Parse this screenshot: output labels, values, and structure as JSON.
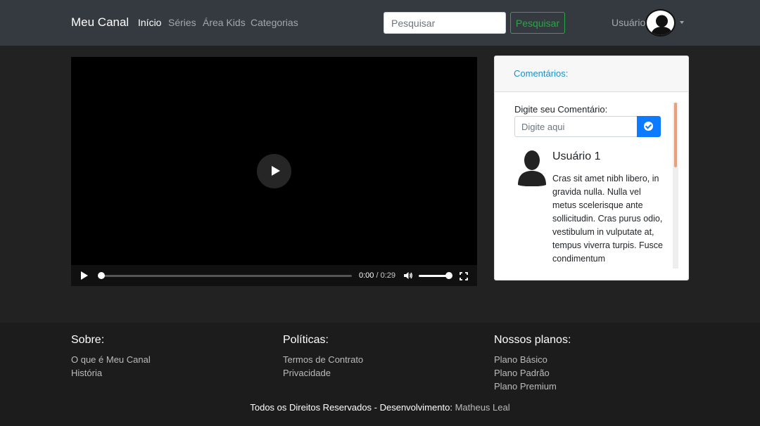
{
  "nav": {
    "brand": "Meu Canal",
    "links": [
      "Início",
      "Séries",
      "Área Kids",
      "Categorias"
    ],
    "search_placeholder": "Pesquisar",
    "search_button": "Pesquisar",
    "user_label": "Usuário"
  },
  "video": {
    "current_time": "0:00",
    "separator": "/",
    "duration": "0:29",
    "progress_fraction": 0,
    "volume_fraction": 1
  },
  "comments": {
    "title": "Comentários:",
    "input_label": "Digite seu Comentário:",
    "input_placeholder": "Digite aqui",
    "items": [
      {
        "user": "Usuário 1",
        "text": "Cras sit amet nibh libero, in gravida nulla. Nulla vel metus scelerisque ante sollicitudin. Cras purus odio, vestibulum in vulputate at, tempus viverra turpis. Fusce condimentum"
      }
    ]
  },
  "footer": {
    "about": {
      "title": "Sobre:",
      "links": [
        "O que é Meu Canal",
        "História"
      ]
    },
    "policies": {
      "title": "Políticas:",
      "links": [
        "Termos de Contrato",
        "Privacidade"
      ]
    },
    "plans": {
      "title": "Nossos planos:",
      "links": [
        "Plano Básico",
        "Plano Padrão",
        "Plano Premium"
      ]
    },
    "copyright_prefix": "Todos os Direitos Reservados - Desenvolvimento:",
    "author": "Matheus Leal"
  },
  "colors": {
    "navbar_bg": "#343a40",
    "page_bg": "#222222",
    "footer_bg": "#1c1c1c",
    "success": "#28a745",
    "primary": "#0d7bff"
  }
}
